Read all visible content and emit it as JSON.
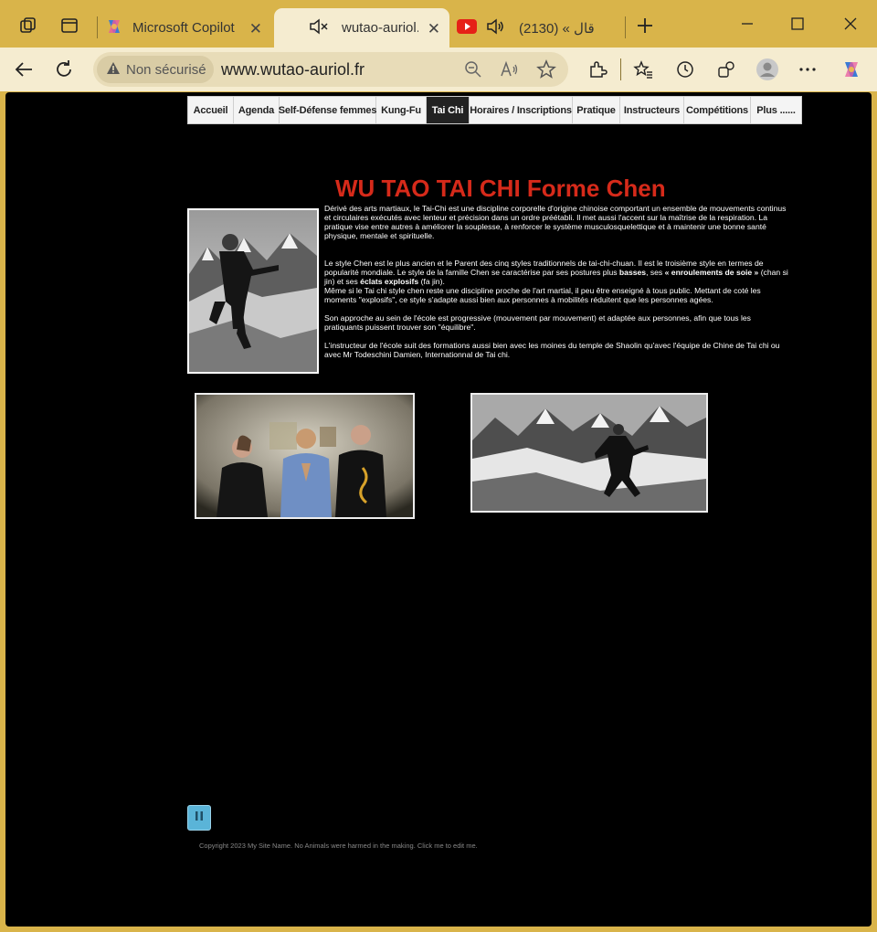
{
  "browser": {
    "tabs": [
      {
        "title": "Microsoft Copilot",
        "active": false
      },
      {
        "title": "wutao-auriol.fr",
        "active": true
      },
      {
        "title": "قال » (2130)",
        "active": false
      }
    ],
    "security_label": "Non sécurisé",
    "url": "www.wutao-auriol.fr"
  },
  "nav": {
    "items": [
      "Accueil",
      "Agenda",
      "Self-Défense femmes",
      "Kung-Fu",
      "Tai Chi",
      "Horaires / Inscriptions",
      "Pratique",
      "Instructeurs",
      "Compétitions",
      "Plus ......"
    ],
    "active": "Tai Chi"
  },
  "content": {
    "heading": "WU TAO TAI CHI Forme Chen",
    "p1": "Dérivé des arts martiaux, le Tai-Chi est une discipline corporelle d'origine chinoise comportant un ensemble de mouvements continus et circulaires exécutés avec lenteur et précision dans un ordre préétabli. Il met aussi l'accent sur la maîtrise de la respiration. La pratique vise entre autres à améliorer la souplesse, à renforcer le système musculosquelettique et à maintenir une bonne santé physique, mentale et spirituelle.",
    "p2a": "Le style Chen est le plus ancien et le Parent des cinq styles traditionnels de tai-chi-chuan.  Il  est le troisième style en termes de popularité mondiale. Le style de la famille Chen se caractérise par ses postures plus ",
    "p2_bold1": "basses",
    "p2b": ", ses ",
    "p2_bold2": "« enroulements de soie »",
    "p2c": " (chan si jin) et ses ",
    "p2_bold3": "éclats explosifs",
    "p2d": " (fa jin).",
    "p3": "Même si le Tai chi style chen reste une discipline proche de l'art martial, il peu être enseigné à tous public. Mettant de coté les moments \"explosifs\", ce style s'adapte aussi bien aux personnes à mobilités réduitent que les personnes agées.",
    "p4": "Son approche au sein de l'école est progressive (mouvement par mouvement) et adaptée aux personnes, afin que tous les  pratiquants puissent trouver son \"équilibre\".",
    "p5": "L'instructeur de l'école suit des formations aussi bien avec les moines du temple de Shaolin qu'avec l'équipe de Chine de Tai chi ou avec Mr Todeschini Damien, Internationnal de Tai chi."
  },
  "footer": "Copyright 2023 My Site Name. No Animals were harmed in the making. Click me to edit me."
}
